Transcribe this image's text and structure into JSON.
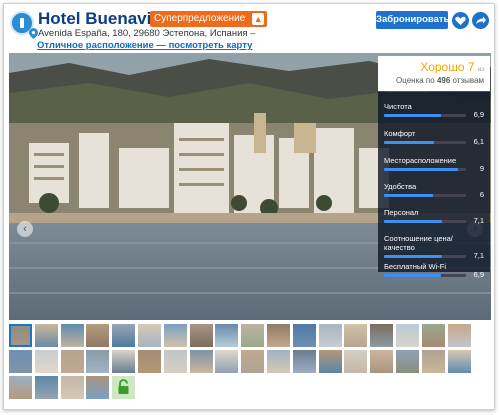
{
  "header": {
    "title": "Hotel Buenavista",
    "promo_label": "Суперпредложение",
    "address": "Avenida España, 180, 29680 Эстепона, Испания –",
    "location_link": "Отличное расположение — посмотреть карту",
    "book_label": "Забронировать"
  },
  "score": {
    "rating": "Хорошо 7",
    "rating_suffix": "из",
    "reviews_prefix": "Оценка по",
    "reviews_count": "496",
    "reviews_suffix": "отзывам"
  },
  "categories": [
    {
      "label": "Чистота",
      "value": "6,9",
      "fraction": 0.69
    },
    {
      "label": "Комфорт",
      "value": "6,1",
      "fraction": 0.61
    },
    {
      "label": "Месторасположение",
      "value": "9",
      "fraction": 0.9
    },
    {
      "label": "Удобства",
      "value": "6",
      "fraction": 0.6
    },
    {
      "label": "Персонал",
      "value": "7,1",
      "fraction": 0.71
    },
    {
      "label": "Соотношение цена/",
      "label2": "качество",
      "value": "7,1",
      "fraction": 0.71
    },
    {
      "label": "Бесплатный Wi-Fi",
      "value": "6,9",
      "fraction": 0.69
    }
  ],
  "nav": {
    "prev": "‹",
    "next": "›"
  },
  "thumbnails": {
    "count": 41,
    "colors": [
      "#8a8f7d",
      "#c9b79a",
      "#5f8cb0",
      "#b39b7f",
      "#97a4b1",
      "#d6c9b5",
      "#7aa0c4",
      "#a89584",
      "#6a8aa8",
      "#bfb2a0",
      "#8f7a68",
      "#4e7aa3",
      "#a7b6c2",
      "#d1c2a8",
      "#7c6d5e",
      "#b7ccd9",
      "#9aa88d",
      "#c4a88c",
      "#6f8fb3",
      "#c8ccd0",
      "#b8a48f",
      "#8d9aa5",
      "#d9d3c7",
      "#a58b73",
      "#c2c5c9",
      "#7f94a8",
      "#e0d7cb",
      "#c0a891",
      "#9fb3c5",
      "#6a7d8e",
      "#b39878",
      "#d5cfc4",
      "#cdb59d",
      "#8fa0b4",
      "#b0a393",
      "#d8c7b3",
      "#9eaec0",
      "#5d85a6",
      "#c4b6a6",
      "#a89481"
    ],
    "lock_icon": "lock-icon"
  }
}
